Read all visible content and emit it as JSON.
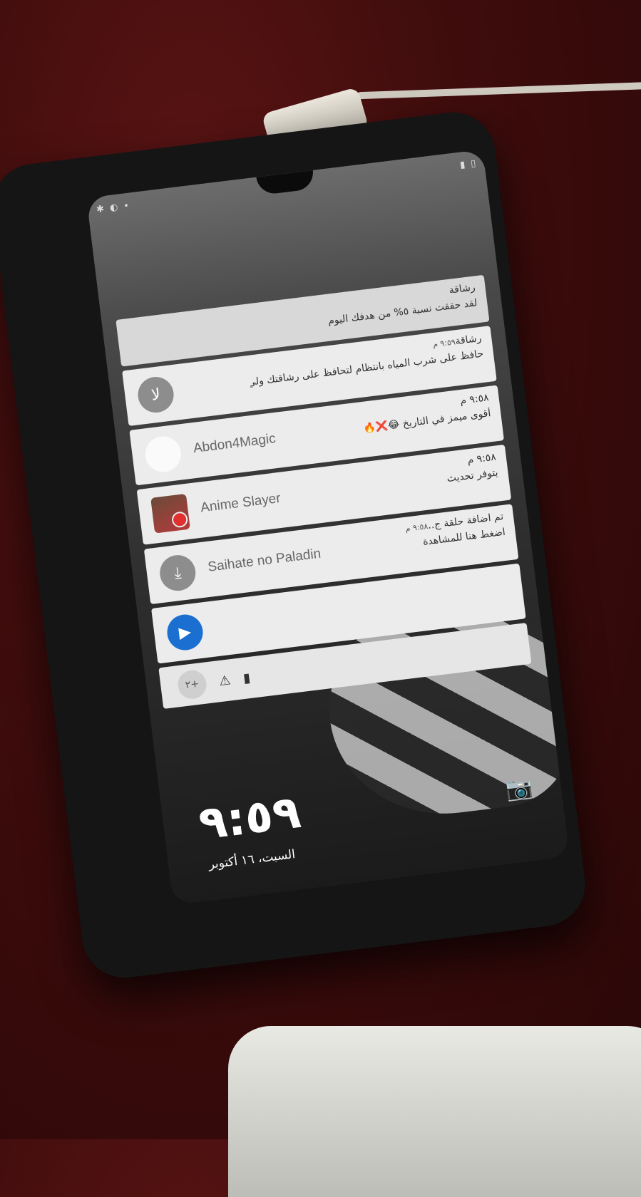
{
  "status_bar": {
    "left_icons": [
      "✱",
      "◐",
      "•"
    ],
    "right_icons": [
      "▮",
      "▯"
    ]
  },
  "notifications": [
    {
      "app": "",
      "title": "رشاقة",
      "text": "لقد حققت نسبة ٥% من هدفك اليوم",
      "time": "",
      "icon": "fitness-icon"
    },
    {
      "app": "",
      "title": "رشاقة",
      "text": "حافظ على شرب المياه بانتظام لتحافظ على رشاقتك ولي",
      "time": "٩:٥٩ م",
      "icon": "app-icon"
    },
    {
      "app": "Abdon4Magic",
      "title": "",
      "text": "أقوى ميمز في التاريخ 😂❌🔥",
      "time": "٩:٥٨ م",
      "icon": "avatar-icon"
    },
    {
      "app": "Anime Slayer",
      "title": "",
      "text": "يتوفر تحديث",
      "time": "٩:٥٨ م",
      "icon": "download-icon"
    },
    {
      "app": "Saihate no Paladin",
      "title": "تم اضافة حلقة ج..",
      "text": "اضغط هنا للمشاهدة",
      "time": "٩:٥٨ م",
      "icon": "tv-icon"
    }
  ],
  "overflow": {
    "more_count": "+٢",
    "icons": [
      "⚠",
      "▮"
    ]
  },
  "lock": {
    "time": "٩:٥٩",
    "date": "السبت، ١٦ أكتوبر",
    "camera_glyph": "📷"
  },
  "glyphs": {
    "fitness": "ﻻ",
    "download": "⤓",
    "tv": "▶"
  }
}
